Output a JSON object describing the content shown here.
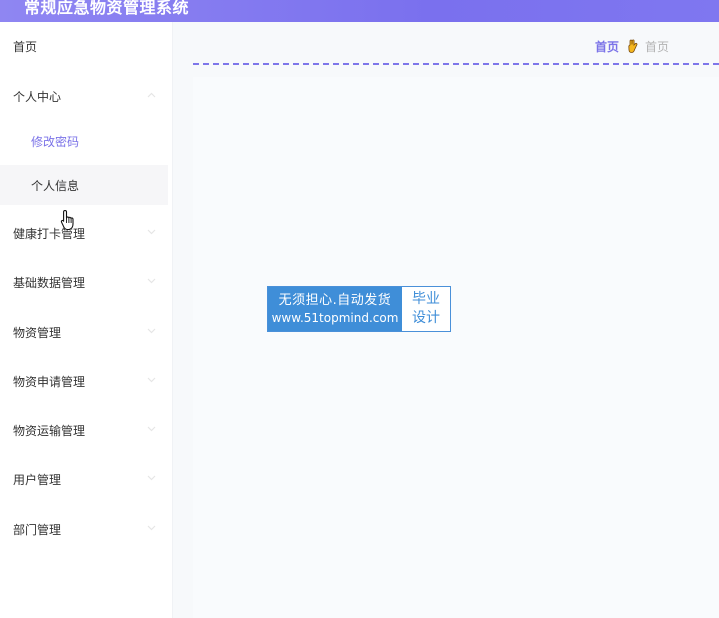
{
  "app": {
    "title": "常规应急物资管理系统"
  },
  "sidebar": {
    "items": [
      {
        "label": "首页"
      },
      {
        "label": "个人中心",
        "children": [
          {
            "label": "修改密码"
          },
          {
            "label": "个人信息"
          }
        ]
      },
      {
        "label": "健康打卡管理"
      },
      {
        "label": "基础数据管理"
      },
      {
        "label": "物资管理"
      },
      {
        "label": "物资申请管理"
      },
      {
        "label": "物资运输管理"
      },
      {
        "label": "用户管理"
      },
      {
        "label": "部门管理"
      }
    ]
  },
  "breadcrumb": {
    "home": "首页",
    "current": "首页",
    "separator_icon": "hand-icon"
  },
  "watermark": {
    "line1": "无须担心.自动发货",
    "line2": "www.51topmind.com",
    "right_line1": "毕业",
    "right_line2": "设计"
  },
  "colors": {
    "accent": "#7b73e8",
    "header": "#8078ef",
    "watermark": "#3f8ed8"
  }
}
